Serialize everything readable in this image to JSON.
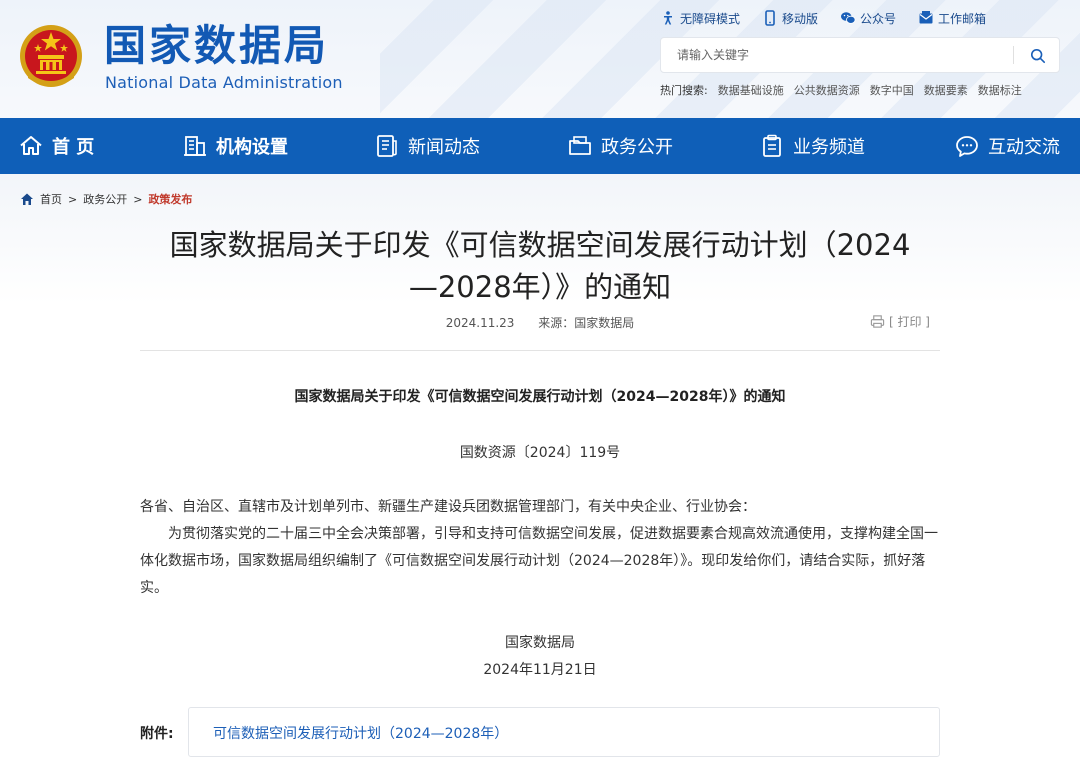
{
  "header": {
    "logo_cn": "国家数据局",
    "logo_en": "National Data Administration",
    "toplinks": [
      {
        "label": "无障碍模式",
        "icon": "accessibility-icon"
      },
      {
        "label": "移动版",
        "icon": "mobile-icon"
      },
      {
        "label": "公众号",
        "icon": "wechat-icon"
      },
      {
        "label": "工作邮箱",
        "icon": "mail-icon"
      }
    ],
    "search": {
      "placeholder": "请输入关键字"
    },
    "hot": {
      "label": "热门搜索:",
      "items": [
        "数据基础设施",
        "公共数据资源",
        "数字中国",
        "数据要素",
        "数据标注"
      ]
    }
  },
  "nav": {
    "items": [
      {
        "label": "首 页",
        "icon": "home-icon"
      },
      {
        "label": "机构设置",
        "icon": "building-icon"
      },
      {
        "label": "新闻动态",
        "icon": "news-icon"
      },
      {
        "label": "政务公开",
        "icon": "folder-icon"
      },
      {
        "label": "业务频道",
        "icon": "clipboard-icon"
      },
      {
        "label": "互动交流",
        "icon": "chat-icon"
      }
    ]
  },
  "breadcrumb": {
    "items": [
      "首页",
      "政务公开"
    ],
    "current": "政策发布"
  },
  "article": {
    "title_line1": "国家数据局关于印发《可信数据空间发展行动计划（2024",
    "title_line2": "—2028年）》的通知",
    "date": "2024.11.23",
    "source": "来源：国家数据局",
    "print": "[ 打印 ]",
    "doc_title": "国家数据局关于印发《可信数据空间发展行动计划（2024—2028年）》的通知",
    "doc_number": "国数资源〔2024〕119号",
    "salutation": "各省、自治区、直辖市及计划单列市、新疆生产建设兵团数据管理部门，有关中央企业、行业协会：",
    "paragraph": "为贯彻落实党的二十届三中全会决策部署，引导和支持可信数据空间发展，促进数据要素合规高效流通使用，支撑构建全国一体化数据市场，国家数据局组织编制了《可信数据空间发展行动计划（2024—2028年）》。现印发给你们，请结合实际，抓好落实。",
    "sign_org": "国家数据局",
    "sign_date": "2024年11月21日",
    "attachment_label": "附件:",
    "attachment_link": "可信数据空间发展行动计划（2024—2028年）"
  },
  "colors": {
    "brand_blue": "#0f5fb8",
    "breadcrumb_current": "#c0392b",
    "link": "#1d5fb7"
  }
}
